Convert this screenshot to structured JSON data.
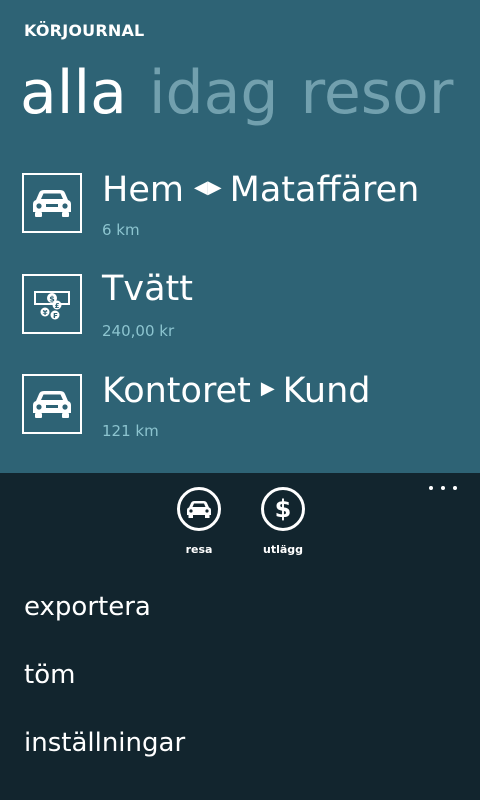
{
  "app": {
    "title": "KÖRJOURNAL"
  },
  "pivot": {
    "items": [
      {
        "label": "alla",
        "active": true
      },
      {
        "label": "idag",
        "active": false
      },
      {
        "label": "resor",
        "active": false
      }
    ]
  },
  "entries": [
    {
      "from": "Hem",
      "arrow": "◀▶",
      "to": "Mataffären",
      "detail": "6 km",
      "icon": "car-icon"
    },
    {
      "from": "Tvätt",
      "arrow": "",
      "to": "",
      "detail": "240,00 kr",
      "icon": "money-icon"
    },
    {
      "from": "Kontoret",
      "arrow": "▶",
      "to": "Kund",
      "detail": "121 km",
      "icon": "car-icon"
    }
  ],
  "appbar": {
    "buttons": [
      {
        "label": "resa",
        "icon": "car-icon"
      },
      {
        "label": "utlägg",
        "icon": "dollar-icon",
        "glyph": "$"
      }
    ],
    "menu": [
      {
        "label": "exportera"
      },
      {
        "label": "töm"
      },
      {
        "label": "inställningar"
      }
    ]
  },
  "colors": {
    "panorama_bg": "#2e6375",
    "appbar_bg": "#12252e",
    "accent_sub": "#8cc4cf",
    "inactive_pivot": "#72a0ae"
  }
}
